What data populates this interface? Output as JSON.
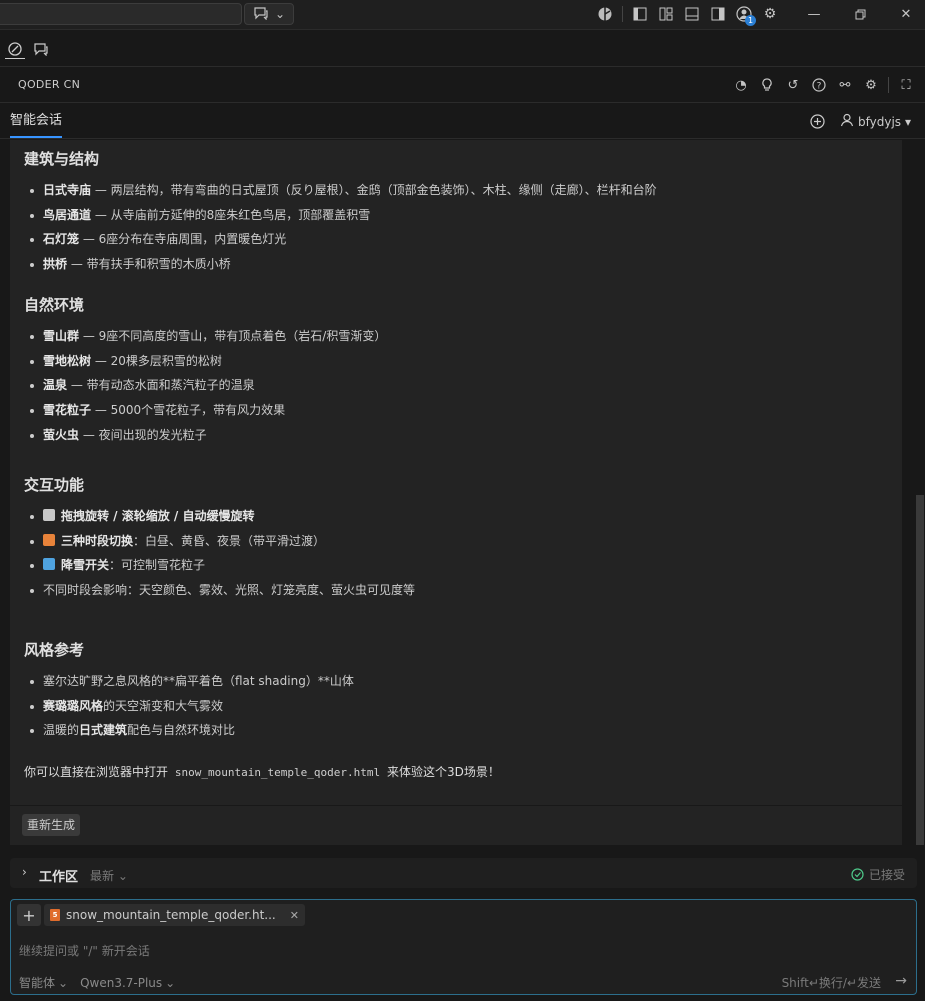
{
  "titlebar": {
    "chat_dropdown_icon": "chat-bubble-icon",
    "account_badge": "1"
  },
  "panel": {
    "title": "QODER CN"
  },
  "tabs": {
    "active_label": "智能会话",
    "user_name": "bfydyjs"
  },
  "content": {
    "sections": [
      {
        "heading": "建筑与结构",
        "items": [
          {
            "bold": "日式寺庙",
            "text": " — 两层结构，带有弯曲的日式屋顶（反り屋根）、金鸱（顶部金色装饰）、木柱、缘侧（走廊）、栏杆和台阶"
          },
          {
            "bold": "鸟居通道",
            "text": " — 从寺庙前方延伸的8座朱红色鸟居，顶部覆盖积雪"
          },
          {
            "bold": "石灯笼",
            "text": " — 6座分布在寺庙周围，内置暖色灯光"
          },
          {
            "bold": "拱桥",
            "text": " — 带有扶手和积雪的木质小桥"
          }
        ]
      },
      {
        "heading": "自然环境",
        "items": [
          {
            "bold": "雪山群",
            "text": " — 9座不同高度的雪山，带有顶点着色（岩石/积雪渐变）"
          },
          {
            "bold": "雪地松树",
            "text": " — 20棵多层积雪的松树"
          },
          {
            "bold": "温泉",
            "text": " — 带有动态水面和蒸汽粒子的温泉"
          },
          {
            "bold": "雪花粒子",
            "text": " — 5000个雪花粒子，带有风力效果"
          },
          {
            "bold": "萤火虫",
            "text": " — 夜间出现的发光粒子"
          }
        ]
      },
      {
        "heading": "交互功能",
        "items": [
          {
            "emoji_color": "#c8c8c8",
            "bold": "拖拽旋转 / 滚轮缩放 / 自动缓慢旋转",
            "text": ""
          },
          {
            "emoji_color": "#e8833a",
            "bold": "三种时段切换",
            "text": "：白昼、黄昏、夜景（带平滑过渡）"
          },
          {
            "emoji_color": "#4fa3e0",
            "bold": "降雪开关",
            "text": "：可控制雪花粒子"
          },
          {
            "bold": "",
            "text": "不同时段会影响：天空颜色、雾效、光照、灯笼亮度、萤火虫可见度等"
          }
        ]
      },
      {
        "heading": "风格参考",
        "items": [
          {
            "bold": "",
            "text": "塞尔达旷野之息风格的**扁平着色（flat shading）**山体"
          },
          {
            "bold": "赛璐璐风格",
            "text": "的天空渐变和大气雾效"
          },
          {
            "prefix": "温暖的",
            "bold": "日式建筑",
            "text": "配色与自然环境对比"
          }
        ]
      }
    ],
    "closing": {
      "before": "你可以直接在浏览器中打开",
      "code": "snow_mountain_temple_qoder.html",
      "after": "来体验这个3D场景！"
    }
  },
  "regenerate_label": "重新生成",
  "workspace": {
    "title": "工作区",
    "sort": "最新",
    "status": "已接受"
  },
  "input": {
    "file_chip": "snow_mountain_temple_qoder.ht...",
    "placeholder": "继续提问或 \"/\" 新开会话",
    "mode": "智能体",
    "model": "Qwen3.7-Plus",
    "send_hint": "Shift↵换行/↵发送"
  }
}
